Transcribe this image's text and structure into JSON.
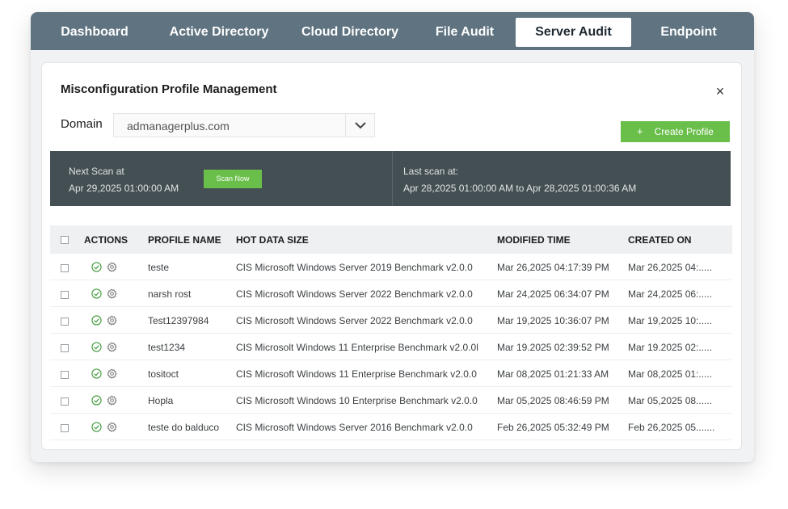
{
  "nav": {
    "tabs": [
      {
        "label": "Dashboard"
      },
      {
        "label": "Active Directory"
      },
      {
        "label": "Cloud Directory"
      },
      {
        "label": "File Audit"
      },
      {
        "label": "Server Audit",
        "active": true
      },
      {
        "label": "Endpoint"
      }
    ]
  },
  "dialog": {
    "title": "Misconfiguration Profile Management",
    "close_symbol": "×",
    "domain_label": "Domain",
    "domain_value": "admanagerplus.com",
    "create_button_plus": "+",
    "create_button_label": "Create Profile"
  },
  "scan": {
    "next_label": "Next Scan at",
    "next_value": "Apr 29,2025 01:00:00 AM",
    "scan_now_label": "Scan Now",
    "last_label": "Last scan at:",
    "last_value": "Apr 28,2025 01:00:00 AM to Apr 28,2025 01:00:36 AM"
  },
  "table": {
    "headers": {
      "actions": "ACTIONS",
      "profile_name": "PROFILE NAME",
      "hot_data_size": "HOT DATA SIZE",
      "modified_time": "MODIFIED TIME",
      "created_on": "CREATED ON"
    },
    "rows": [
      {
        "name": "teste",
        "benchmark": "CIS Microsoft Windows Server 2019 Benchmark v2.0.0",
        "modified": "Mar 26,2025 04:17:39 PM",
        "created": "Mar 26,2025 04:....."
      },
      {
        "name": "narsh rost",
        "benchmark": "CIS Microsoft Windows Server 2022 Benchmark v2.0.0",
        "modified": "Mar 24,2025 06:34:07 PM",
        "created": "Mar 24,2025 06:....."
      },
      {
        "name": "Test12397984",
        "benchmark": "CIS Microsoft Windows Server 2022 Benchmark v2.0.0",
        "modified": "Mar 19,2025 10:36:07 PM",
        "created": "Mar 19,2025 10:....."
      },
      {
        "name": "test1234",
        "benchmark": "CIS Microsolt Windows 11 Enterprise Benchmark v2.0.0l",
        "modified": "Mar 19.2025 02:39:52 PM",
        "created": "Mar 19.2025 02:....."
      },
      {
        "name": "tositoct",
        "benchmark": "CIS Microsoft Windows 11 Enterprise Benchmark v2.0.0",
        "modified": "Mar 08,2025 01:21:33 AM",
        "created": "Mar 08,2025 01:....."
      },
      {
        "name": "Hopla",
        "benchmark": "CIS Microsoft Windows 10 Enterprise Benchmark v2.0.0",
        "modified": "Mar 05,2025 08:46:59 PM",
        "created": "Mar 05,2025 08......"
      },
      {
        "name": "teste do balduco",
        "benchmark": "CIS Microsoft Windows Server 2016 Benchmark v2.0.0",
        "modified": "Feb 26,2025 05:32:49 PM",
        "created": "Feb 26,2025 05......."
      }
    ]
  },
  "colors": {
    "nav_bg": "#5f7380",
    "accent_green": "#6abf4b",
    "scan_bar_bg": "#444f54"
  }
}
